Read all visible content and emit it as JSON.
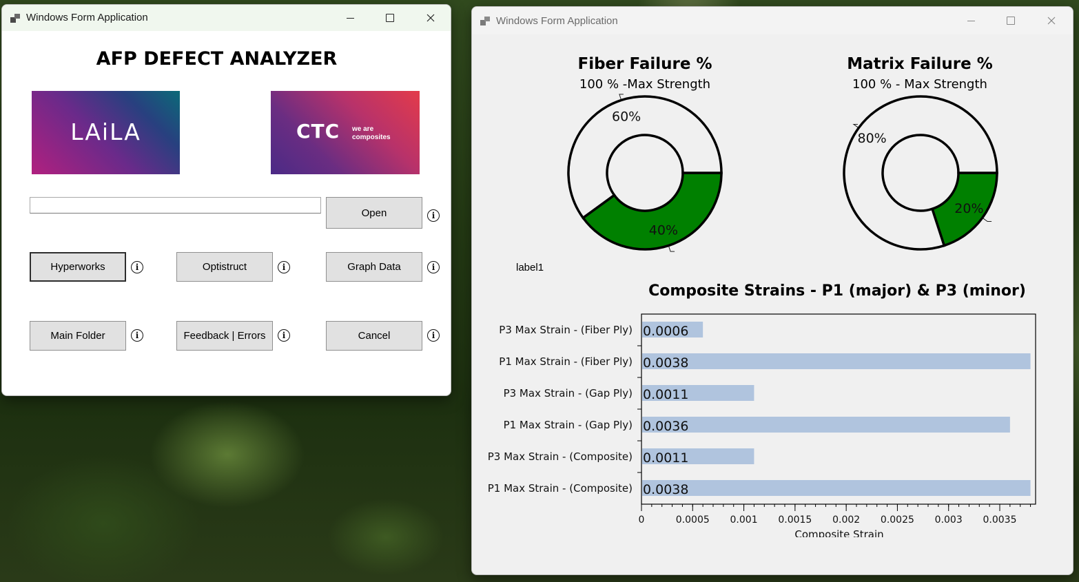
{
  "left_window": {
    "title": "Windows Form Application",
    "heading": "AFP DEFECT ANALYZER",
    "logo_laila": {
      "text": "LAiLA"
    },
    "logo_ctc": {
      "text": "CTC",
      "tagline_line1": "we are",
      "tagline_line2": "composites"
    },
    "path_input": {
      "value": ""
    },
    "buttons": {
      "open": "Open",
      "hyperworks": "Hyperworks",
      "optistruct": "Optistruct",
      "graph_data": "Graph Data",
      "main_folder": "Main Folder",
      "feedback": "Feedback | Errors",
      "cancel": "Cancel"
    }
  },
  "right_window": {
    "title": "Windows Form Application",
    "label1": "label1",
    "fiber": {
      "title": "Fiber Failure %",
      "subtitle": "100 % -Max Strength",
      "slices": [
        {
          "label": "40%",
          "value": 40,
          "color": "#008000"
        },
        {
          "label": "60%",
          "value": 60,
          "color": "#f0f0f0"
        }
      ]
    },
    "matrix": {
      "title": "Matrix Failure %",
      "subtitle": "100 % - Max Strength",
      "slices": [
        {
          "label": "20%",
          "value": 20,
          "color": "#008000"
        },
        {
          "label": "80%",
          "value": 80,
          "color": "#f0f0f0"
        }
      ]
    }
  },
  "chart_data": [
    {
      "type": "pie",
      "title": "Fiber Failure %",
      "subtitle": "100 % -Max Strength",
      "categories": [
        "40%",
        "60%"
      ],
      "values": [
        40,
        60
      ]
    },
    {
      "type": "pie",
      "title": "Matrix Failure %",
      "subtitle": "100 % - Max Strength",
      "categories": [
        "20%",
        "80%"
      ],
      "values": [
        20,
        80
      ]
    },
    {
      "type": "bar",
      "orientation": "horizontal",
      "title": "Composite Strains - P1 (major) & P3 (minor)",
      "xlabel": "Composite Strain",
      "ylabel": "",
      "categories": [
        "P3 Max Strain - (Fiber Ply)",
        "P1 Max Strain - (Fiber Ply)",
        "P3 Max Strain - (Gap Ply)",
        "P1 Max Strain - (Gap Ply)",
        "P3 Max Strain - (Composite)",
        "P1 Max Strain - (Composite)"
      ],
      "values": [
        0.0006,
        0.0038,
        0.0011,
        0.0036,
        0.0011,
        0.0038
      ],
      "value_labels": [
        "0.0006",
        "0.0038",
        "0.0011",
        "0.0036",
        "0.0011",
        "0.0038"
      ],
      "xticks": [
        "0",
        "0.0005",
        "0.001",
        "0.0015",
        "0.002",
        "0.0025",
        "0.003",
        "0.0035"
      ],
      "xlim": [
        0,
        0.00385
      ],
      "bar_color": "#b0c4de"
    }
  ]
}
